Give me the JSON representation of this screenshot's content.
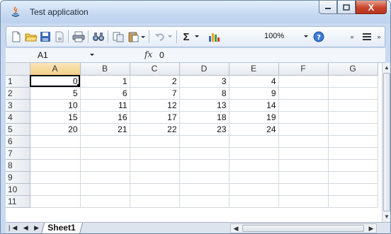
{
  "window": {
    "title": "Test application",
    "close_glyph": "X"
  },
  "toolbar": {
    "zoom": "100%"
  },
  "formula_bar": {
    "cell_ref": "A1",
    "fx_label": "fx",
    "value": "0"
  },
  "grid": {
    "columns": [
      "A",
      "B",
      "C",
      "D",
      "E",
      "F",
      "G"
    ],
    "rows": [
      {
        "num": "1",
        "cells": [
          "0",
          "1",
          "2",
          "3",
          "4",
          "",
          ""
        ]
      },
      {
        "num": "2",
        "cells": [
          "5",
          "6",
          "7",
          "8",
          "9",
          "",
          ""
        ]
      },
      {
        "num": "3",
        "cells": [
          "10",
          "11",
          "12",
          "13",
          "14",
          "",
          ""
        ]
      },
      {
        "num": "4",
        "cells": [
          "15",
          "16",
          "17",
          "18",
          "19",
          "",
          ""
        ]
      },
      {
        "num": "5",
        "cells": [
          "20",
          "21",
          "22",
          "23",
          "24",
          "",
          ""
        ]
      },
      {
        "num": "6",
        "cells": [
          "",
          "",
          "",
          "",
          "",
          "",
          ""
        ]
      },
      {
        "num": "7",
        "cells": [
          "",
          "",
          "",
          "",
          "",
          "",
          ""
        ]
      },
      {
        "num": "8",
        "cells": [
          "",
          "",
          "",
          "",
          "",
          "",
          ""
        ]
      },
      {
        "num": "9",
        "cells": [
          "",
          "",
          "",
          "",
          "",
          "",
          ""
        ]
      },
      {
        "num": "10",
        "cells": [
          "",
          "",
          "",
          "",
          "",
          "",
          ""
        ]
      },
      {
        "num": "11",
        "cells": [
          "",
          "",
          "",
          "",
          "",
          "",
          ""
        ]
      }
    ]
  },
  "sheets": {
    "active": "Sheet1"
  },
  "colors": {
    "title_bg": "#c6d9f1",
    "close_red": "#c9442a",
    "selection_header": "#f2d08a"
  }
}
